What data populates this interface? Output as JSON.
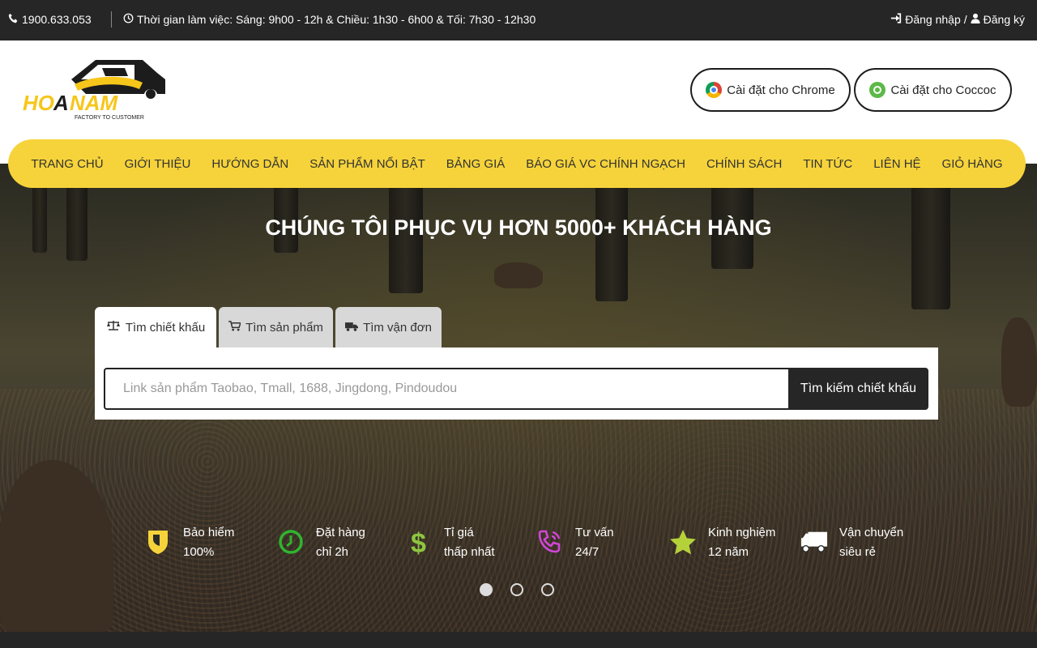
{
  "topbar": {
    "phone": "1900.633.053",
    "hours": "Thời gian làm việc: Sáng: 9h00 - 12h & Chiều: 1h30 - 6h00 & Tối: 7h30 - 12h30",
    "login": "Đăng nhập",
    "divider": "/",
    "register": "Đăng ký"
  },
  "header": {
    "logo_text": "HOANAM",
    "logo_tagline": "FACTORY TO CUSTOMER",
    "chrome_button": "Cài đặt cho Chrome",
    "coccoc_button": "Cài đặt cho Coccoc"
  },
  "nav": {
    "items": [
      "TRANG CHỦ",
      "GIỚI THIỆU",
      "HƯỚNG DẪN",
      "SẢN PHẨM NỔI BẬT",
      "BẢNG GIÁ",
      "BÁO GIÁ VC CHÍNH NGẠCH",
      "CHÍNH SÁCH",
      "TIN TỨC",
      "LIÊN HỆ",
      "GIỎ HÀNG"
    ]
  },
  "hero": {
    "title": "CHÚNG TÔI PHỤC VỤ HƠN 5000+ KHÁCH HÀNG"
  },
  "search": {
    "tabs": [
      "Tìm chiết khấu",
      "Tìm sản phẩm",
      "Tìm vận đơn"
    ],
    "active_tab": "Tìm chiết khấu",
    "placeholder": "Link sản phẩm Taobao, Tmall, 1688, Jingdong, Pindoudou",
    "button": "Tìm kiếm chiết khấu"
  },
  "features": [
    {
      "line1": "Bảo hiểm",
      "line2": "100%",
      "icon": "shield-icon",
      "color": "#f6d33a"
    },
    {
      "line1": "Đặt hàng",
      "line2": "chỉ 2h",
      "icon": "clock-icon",
      "color": "#2fb52f"
    },
    {
      "line1": "Tỉ giá",
      "line2": "thấp nhất",
      "icon": "dollar-icon",
      "color": "#8dc63f"
    },
    {
      "line1": "Tư vấn",
      "line2": "24/7",
      "icon": "phone-volume-icon",
      "color": "#d146d6"
    },
    {
      "line1": "Kinh nghiệm",
      "line2": "12 năm",
      "icon": "star-icon",
      "color": "#b5d13a"
    },
    {
      "line1": "Vận chuyển",
      "line2": "siêu rẻ",
      "icon": "truck-icon",
      "color": "#ffffff"
    }
  ],
  "carousel": {
    "slides": 3,
    "active": 1
  }
}
